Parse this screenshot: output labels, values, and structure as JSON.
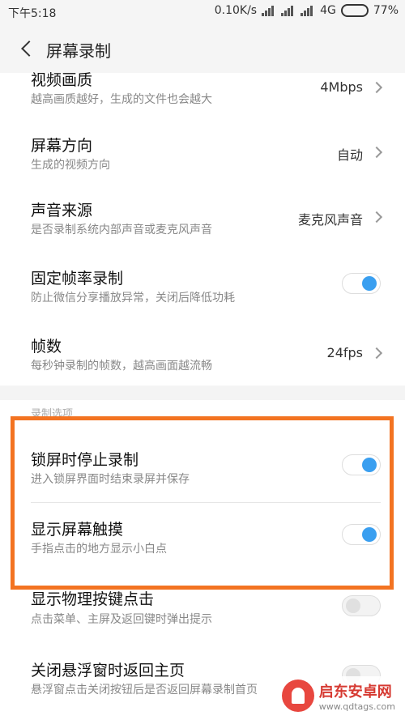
{
  "status": {
    "time": "下午5:18",
    "speed": "0.10K/s",
    "network": "4G",
    "battery_percent_text": "77%",
    "battery_level": 0.77
  },
  "header": {
    "title": "屏幕录制"
  },
  "settings": [
    {
      "label": "视频画质",
      "sub": "越高画质越好，生成的文件也会越大",
      "value": "4Mbps",
      "type": "nav"
    },
    {
      "label": "屏幕方向",
      "sub": "生成的视频方向",
      "value": "自动",
      "type": "nav"
    },
    {
      "label": "声音来源",
      "sub": "是否录制系统内部声音或麦克风声音",
      "value": "麦克风声音",
      "type": "nav"
    },
    {
      "label": "固定帧率录制",
      "sub": "防止微信分享播放异常，关闭后降低功耗",
      "type": "toggle",
      "on": true
    },
    {
      "label": "帧数",
      "sub": "每秒钟录制的帧数，越高画面越流畅",
      "value": "24fps",
      "type": "nav"
    }
  ],
  "section2": {
    "header": "录制选项",
    "items": [
      {
        "label": "锁屏时停止录制",
        "sub": "进入锁屏界面时结束录屏并保存",
        "type": "toggle",
        "on": true
      },
      {
        "label": "显示屏幕触摸",
        "sub": "手指点击的地方显示小白点",
        "type": "toggle",
        "on": true
      },
      {
        "label": "显示物理按键点击",
        "sub": "点击菜单、主屏及返回键时弹出提示",
        "type": "toggle",
        "on": false
      },
      {
        "label": "关闭悬浮窗时返回主页",
        "sub": "悬浮窗点击关闭按钮后是否返回屏幕录制首页",
        "type": "toggle",
        "on": false
      }
    ]
  },
  "watermark": {
    "name": "启东安卓网",
    "url": "www.qdtags.com"
  },
  "colors": {
    "highlight": "#f37321",
    "toggle_on": "#3a9ff0",
    "battery": "#2ec13b"
  }
}
